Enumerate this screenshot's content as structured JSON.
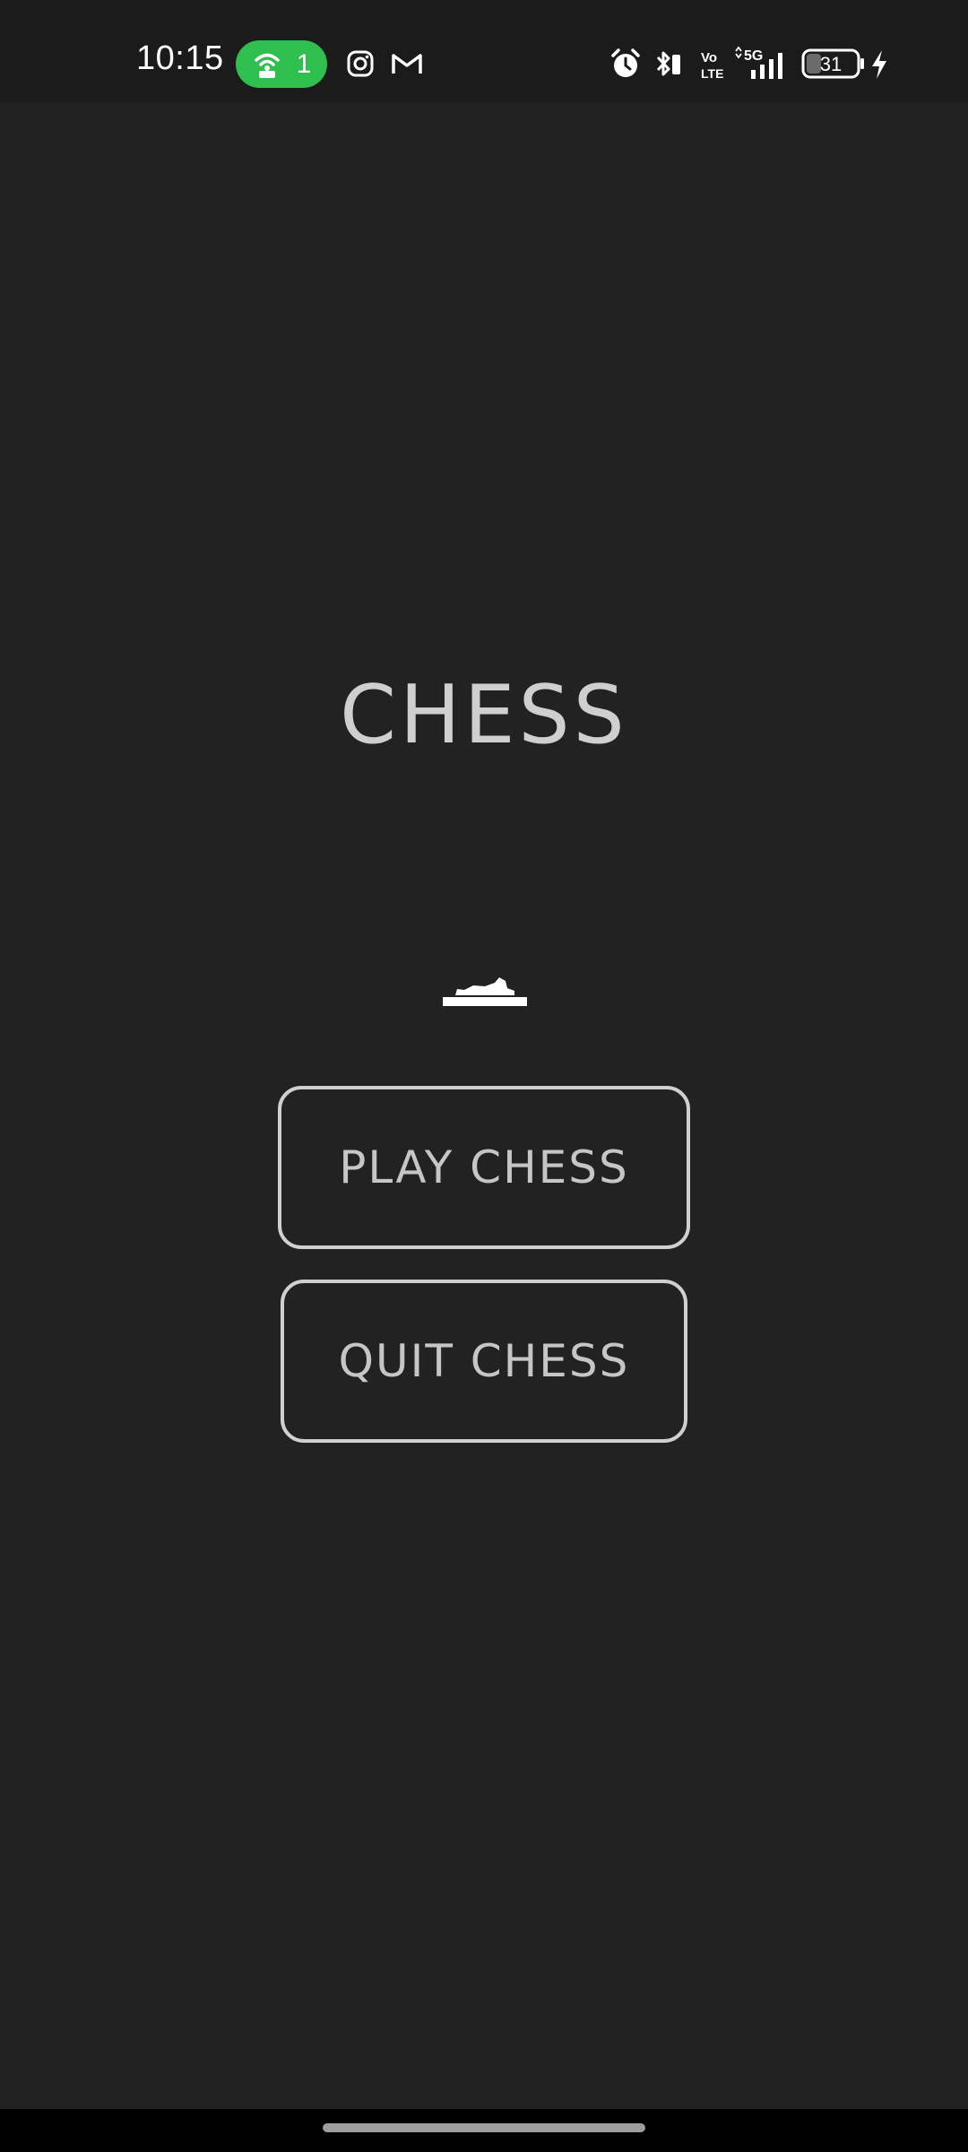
{
  "status_bar": {
    "time": "10:15",
    "hotspot_count": "1",
    "battery_level": "31",
    "network_label": "5G",
    "volte_label_top": "Vo",
    "volte_label_bottom": "LTE",
    "icons": [
      "hotspot-icon",
      "instagram-icon",
      "gmail-icon",
      "alarm-icon",
      "bluetooth-icon",
      "volte-icon",
      "signal-icon",
      "battery-icon",
      "charging-icon"
    ],
    "hotspot_color": "#2fbf4f"
  },
  "main": {
    "title": "CHESS",
    "logo_icon": "chess-piece-icon",
    "play_button_label": "PLAY CHESS",
    "quit_button_label": "QUIT CHESS"
  },
  "colors": {
    "background": "#222222",
    "text": "#c8c8c8",
    "button_border": "#d0d0d0"
  }
}
